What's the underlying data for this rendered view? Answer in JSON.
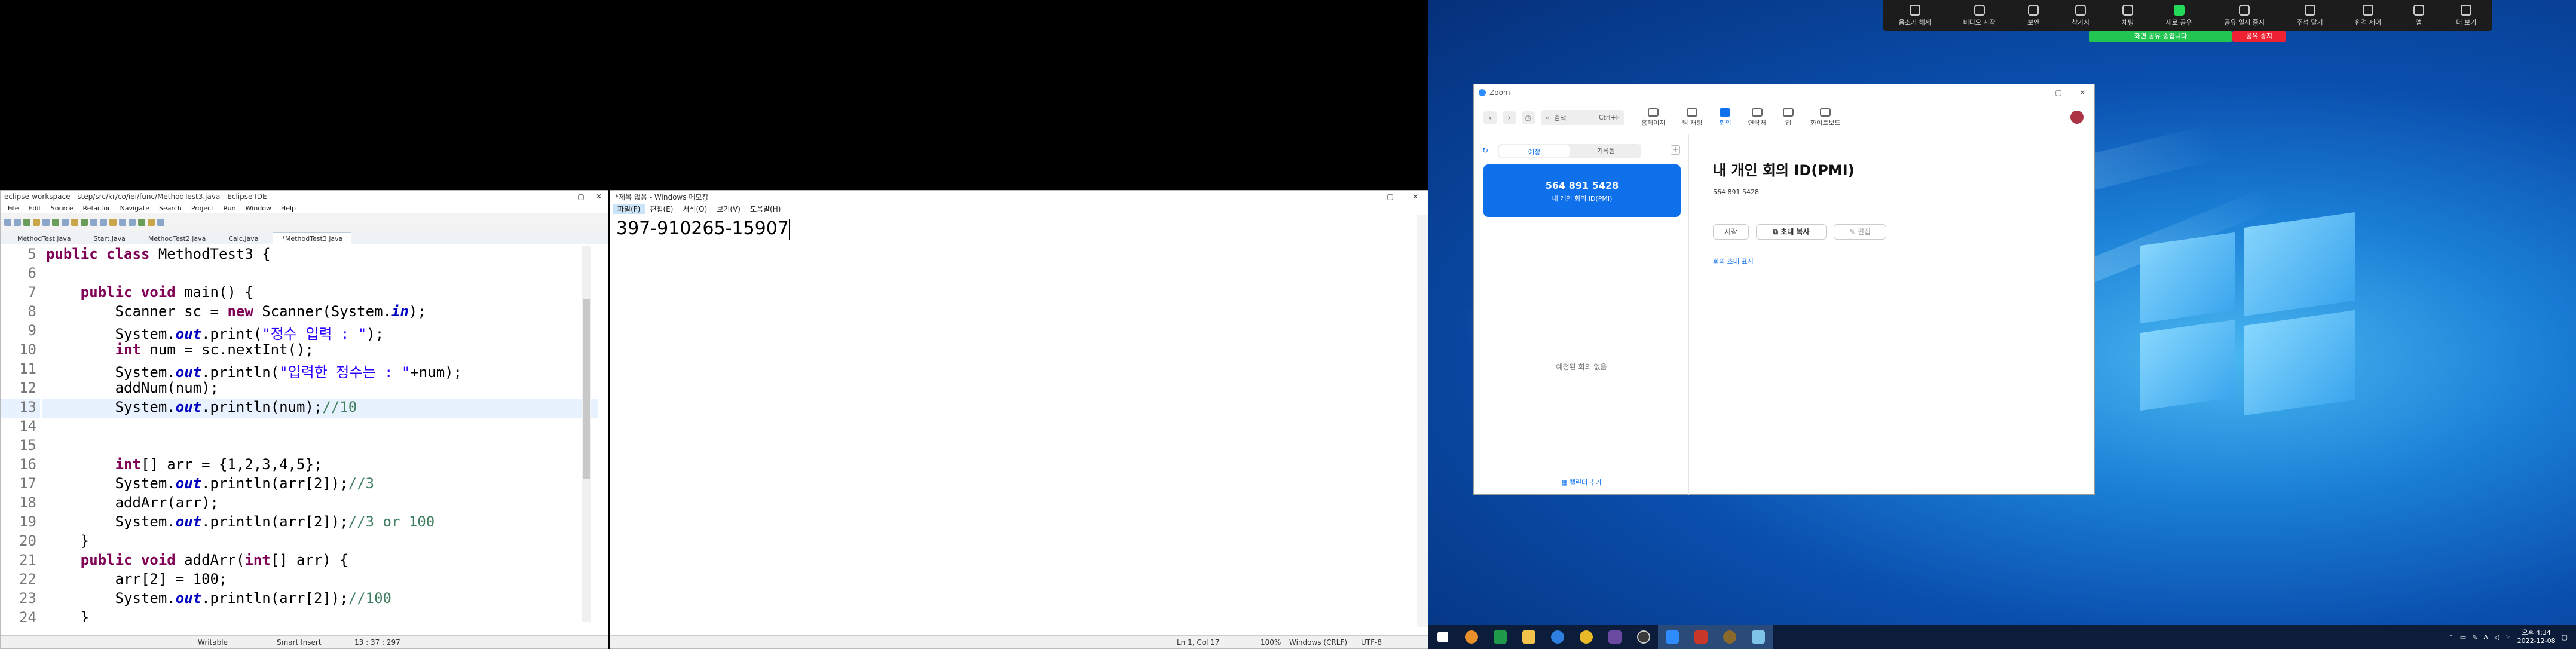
{
  "eclipse": {
    "title": "eclipse-workspace - step/src/kr/co/iei/func/MethodTest3.java - Eclipse IDE",
    "window_controls": [
      "—",
      "▢",
      "✕"
    ],
    "menu": [
      "File",
      "Edit",
      "Source",
      "Refactor",
      "Navigate",
      "Search",
      "Project",
      "Run",
      "Window",
      "Help"
    ],
    "tabs": [
      "MethodTest.java",
      "Start.java",
      "MethodTest2.java",
      "Calc.java",
      "*MethodTest3.java"
    ],
    "active_tab_index": 4,
    "lines": [
      {
        "n": "5",
        "segs": [
          {
            "t": "public class ",
            "c": "kw"
          },
          {
            "t": "MethodTest3 {",
            "c": ""
          }
        ]
      },
      {
        "n": "6",
        "segs": []
      },
      {
        "n": "7",
        "segs": [
          {
            "t": "    public void ",
            "c": "kw"
          },
          {
            "t": "main() {",
            "c": ""
          }
        ]
      },
      {
        "n": "8",
        "segs": [
          {
            "t": "        Scanner sc = ",
            "c": ""
          },
          {
            "t": "new ",
            "c": "kw"
          },
          {
            "t": "Scanner(System.",
            "c": ""
          },
          {
            "t": "in",
            "c": "fld"
          },
          {
            "t": ");",
            "c": ""
          }
        ]
      },
      {
        "n": "9",
        "segs": [
          {
            "t": "        System.",
            "c": ""
          },
          {
            "t": "out",
            "c": "fld"
          },
          {
            "t": ".print(",
            "c": ""
          },
          {
            "t": "\"정수 입력 : \"",
            "c": "str"
          },
          {
            "t": ");",
            "c": ""
          }
        ]
      },
      {
        "n": "10",
        "segs": [
          {
            "t": "        int ",
            "c": "kw"
          },
          {
            "t": "num = sc.nextInt();",
            "c": ""
          }
        ]
      },
      {
        "n": "11",
        "segs": [
          {
            "t": "        System.",
            "c": ""
          },
          {
            "t": "out",
            "c": "fld"
          },
          {
            "t": ".println(",
            "c": ""
          },
          {
            "t": "\"입력한 정수는 : \"",
            "c": "str"
          },
          {
            "t": "+num);",
            "c": ""
          }
        ]
      },
      {
        "n": "12",
        "segs": [
          {
            "t": "        addNum(num);",
            "c": ""
          }
        ]
      },
      {
        "n": "13",
        "segs": [
          {
            "t": "        System.",
            "c": ""
          },
          {
            "t": "out",
            "c": "fld"
          },
          {
            "t": ".println(num);",
            "c": ""
          },
          {
            "t": "//10",
            "c": "cm"
          }
        ],
        "hl": true
      },
      {
        "n": "14",
        "segs": []
      },
      {
        "n": "15",
        "segs": []
      },
      {
        "n": "16",
        "segs": [
          {
            "t": "        int",
            "c": "kw"
          },
          {
            "t": "[] arr = {1,2,3,4,5};",
            "c": ""
          }
        ]
      },
      {
        "n": "17",
        "segs": [
          {
            "t": "        System.",
            "c": ""
          },
          {
            "t": "out",
            "c": "fld"
          },
          {
            "t": ".println(arr[2]);",
            "c": ""
          },
          {
            "t": "//3",
            "c": "cm"
          }
        ]
      },
      {
        "n": "18",
        "segs": [
          {
            "t": "        addArr(arr);",
            "c": ""
          }
        ]
      },
      {
        "n": "19",
        "segs": [
          {
            "t": "        System.",
            "c": ""
          },
          {
            "t": "out",
            "c": "fld"
          },
          {
            "t": ".println(arr[2]);",
            "c": ""
          },
          {
            "t": "//3 or 100",
            "c": "cm"
          }
        ]
      },
      {
        "n": "20",
        "segs": [
          {
            "t": "    }",
            "c": ""
          }
        ]
      },
      {
        "n": "21",
        "segs": [
          {
            "t": "    public void ",
            "c": "kw"
          },
          {
            "t": "addArr(",
            "c": ""
          },
          {
            "t": "int",
            "c": "kw"
          },
          {
            "t": "[] arr) {",
            "c": ""
          }
        ]
      },
      {
        "n": "22",
        "segs": [
          {
            "t": "        arr[2] = 100;",
            "c": ""
          }
        ]
      },
      {
        "n": "23",
        "segs": [
          {
            "t": "        System.",
            "c": ""
          },
          {
            "t": "out",
            "c": "fld"
          },
          {
            "t": ".println(arr[2]);",
            "c": ""
          },
          {
            "t": "//100",
            "c": "cm"
          }
        ]
      },
      {
        "n": "24",
        "segs": [
          {
            "t": "    }",
            "c": ""
          }
        ]
      }
    ],
    "status": {
      "mode": "Writable",
      "insert": "Smart Insert",
      "position": "13 : 37 : 297"
    }
  },
  "notepad": {
    "title": "*제목 없음 - Windows 메모장",
    "window_controls": [
      "—",
      "▢",
      "✕"
    ],
    "menu": [
      "파일(F)",
      "편집(E)",
      "서식(O)",
      "보기(V)",
      "도움말(H)"
    ],
    "content": "397-910265-15907",
    "status": {
      "pos": "Ln 1, Col 17",
      "zoom": "100%",
      "eol": "Windows (CRLF)",
      "enc": "UTF-8"
    }
  },
  "zoom_toolbar": {
    "items": [
      "음소거 해제",
      "비디오 시작",
      "보안",
      "참가자",
      "채팅",
      "새로 공유",
      "공유 일시 중지",
      "주석 달기",
      "원격 제어",
      "앱",
      "더 보기"
    ],
    "share_banner": "화면 공유 중입니다",
    "stop_share": "공유 중지"
  },
  "zoom": {
    "title": "Zoom",
    "window_controls": [
      "—",
      "▢",
      "✕"
    ],
    "search_label": "검색",
    "search_shortcut": "Ctrl+F",
    "nav_tabs": [
      "홈페이지",
      "팀 채팅",
      "회의",
      "연락처",
      "앱",
      "화이트보드"
    ],
    "active_nav_index": 2,
    "segments": [
      "예정",
      "기록됨"
    ],
    "pmi_number": "564 891 5428",
    "pmi_card_label": "내 개인 회의 ID(PMI)",
    "empty_text": "예정된 회의 없음",
    "calendar_link": "캘린더 추가",
    "heading": "내 개인 회의 ID(PMI)",
    "id_text": "564 891 5428",
    "btn_start": "시작",
    "btn_copy": "초대 복사",
    "btn_edit": "편집",
    "invite_link": "회의 초대 표시"
  },
  "taskbar": {
    "time": "오후 4:34",
    "date": "2022-12-08",
    "tray_lang": "A"
  }
}
